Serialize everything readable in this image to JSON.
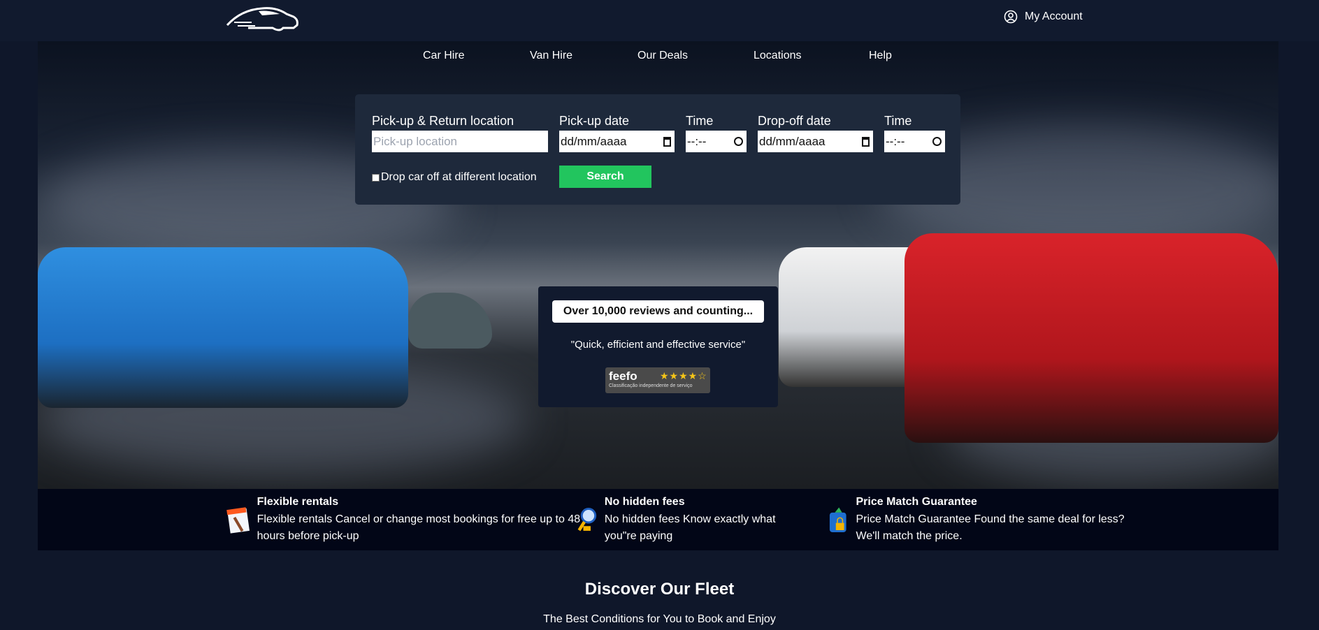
{
  "header": {
    "account_label": "My Account"
  },
  "nav": {
    "items": [
      {
        "label": "Car Hire"
      },
      {
        "label": "Van Hire"
      },
      {
        "label": "Our Deals"
      },
      {
        "label": "Locations"
      },
      {
        "label": "Help"
      }
    ]
  },
  "search": {
    "location_label": "Pick-up & Return location",
    "location_placeholder": "Pick-up location",
    "pickup_date_label": "Pick-up date",
    "pickup_date_value": "dd/mm/aaaa",
    "pickup_time_label": "Time",
    "pickup_time_value": "--:--",
    "dropoff_date_label": "Drop-off date",
    "dropoff_date_value": "dd/mm/aaaa",
    "dropoff_time_label": "Time",
    "dropoff_time_value": "--:--",
    "different_location_label": "Drop car off at different location",
    "different_location_checked": false,
    "search_button": "Search",
    "accent": "#22c55e"
  },
  "review": {
    "headline": "Over 10,000 reviews and counting...",
    "quote": "\"Quick, efficient and effective service\"",
    "feefo_logo": "feefo",
    "feefo_rating": 4,
    "feefo_tagline": "Classificação independente de serviço"
  },
  "features": [
    {
      "icon": "calendar-icon",
      "title": "Flexible rentals",
      "text": "Flexible rentals Cancel or change most bookings for free up to 48 hours before pick-up"
    },
    {
      "icon": "magnifier-icon",
      "title": "No hidden fees",
      "text": "No hidden fees Know exactly what you\"re paying"
    },
    {
      "icon": "padlock-icon",
      "title": "Price Match Guarantee",
      "text": "Price Match Guarantee Found the same deal for less? We'll match the price."
    }
  ],
  "fleet": {
    "title": "Discover Our Fleet",
    "subtitle": "The Best Conditions for You to Book and Enjoy"
  }
}
